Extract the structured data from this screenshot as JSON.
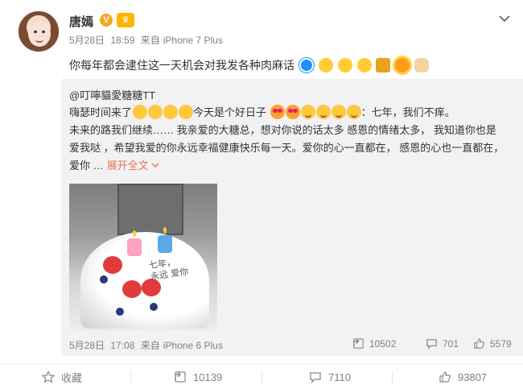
{
  "author": {
    "name": "唐嫣",
    "vip_badge": "V",
    "crown_badge": "♛"
  },
  "post": {
    "date": "5月28日",
    "time": "18:59",
    "source_prefix": "来自",
    "source_device": "iPhone 7 Plus",
    "text": "你每年都会逮住这一天机会对我发各种肉麻话",
    "emoji_icons": [
      "doraemon-icon",
      "laugh-cry-icon",
      "glasses-icon",
      "cover-mouth-icon",
      "beer-icon",
      "sun-icon",
      "victory-hand-icon"
    ]
  },
  "retweet": {
    "author": "@叮嚀貓愛糖糖TT",
    "line1_a": "嗨瑟时间来了",
    "line1_b": "今天是个好日子",
    "line1_c": "：七年，我们不痒。",
    "line2": "未来的路我们继续…… 我亲爱的大糖总，想对你说的话太多 感恩的情绪太多， 我知道你也是",
    "line3": "爱我哒 ，希望我爱的你永远幸福健康快乐每一天。爱你的心一直都在， 感恩的心也一直都在，",
    "line4": "爱你 …",
    "expand_label": "展开全文",
    "photo_writing_1": "七年，",
    "photo_writing_2": "永远 爱你",
    "date": "5月28日",
    "time": "17:08",
    "source_prefix": "来自",
    "source_device": "iPhone 6 Plus",
    "reposts": "10502",
    "comments": "701",
    "likes": "5579"
  },
  "actions": {
    "favorite_label": "收藏",
    "reposts": "10139",
    "comments": "7110",
    "likes": "93807"
  },
  "colors": {
    "link_orange": "#eb7350",
    "badge_gold": "#f5a623",
    "meta_gray": "#808080",
    "retweet_bg": "#f2f2f5"
  }
}
